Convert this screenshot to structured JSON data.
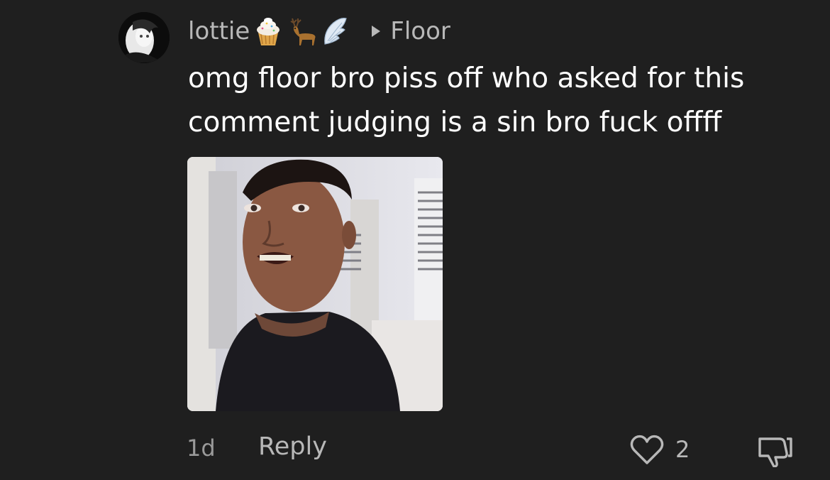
{
  "comment": {
    "username": "lottie",
    "badges": [
      "cupcake-icon",
      "deer-icon",
      "wing-icon"
    ],
    "reply_to": "Floor",
    "text_lines": [
      "omg floor bro piss off who asked for this",
      "comment judging is a sin bro fuck offff"
    ],
    "time": "1d",
    "reply_label": "Reply",
    "like_count": "2"
  },
  "colors": {
    "background": "#1f1f1f",
    "text_primary": "#ffffff",
    "text_secondary": "#b8b8b8"
  }
}
